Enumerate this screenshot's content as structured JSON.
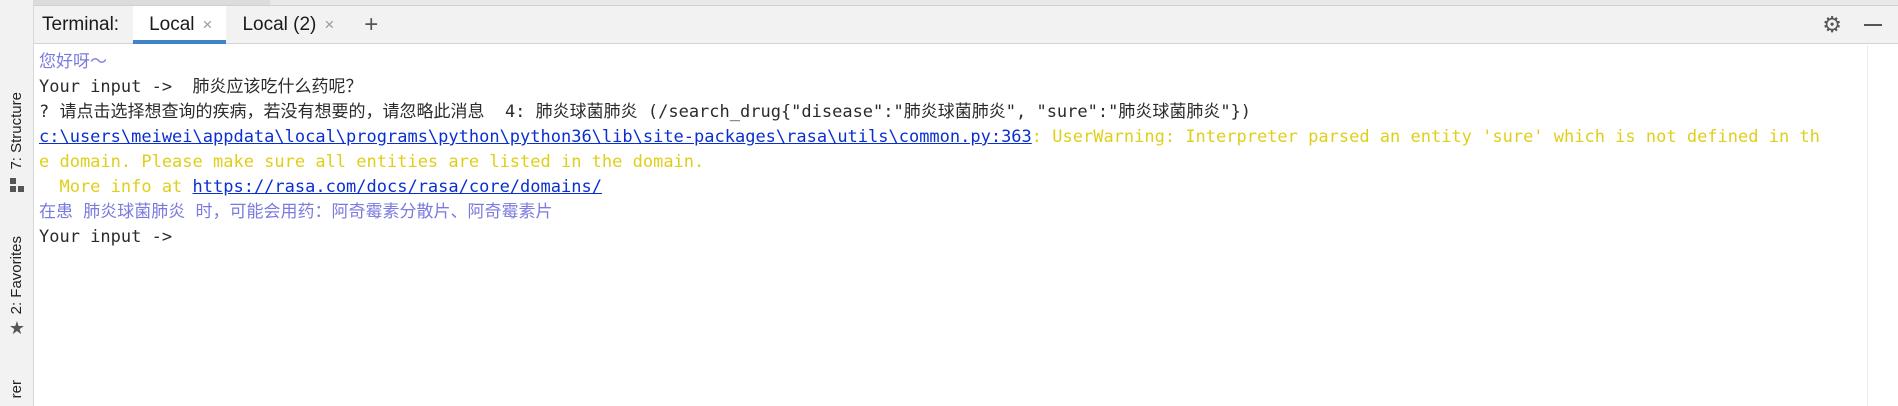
{
  "sidebar": {
    "structure_label": "7: Structure",
    "favorites_label": "2: Favorites",
    "explorer_label": "rer"
  },
  "tab_bar": {
    "title": "Terminal:",
    "tabs": [
      {
        "label": "Local",
        "active": true
      },
      {
        "label": "Local (2)",
        "active": false
      }
    ],
    "close_glyph": "×",
    "add_glyph": "+"
  },
  "terminal": {
    "greeting": "您好呀～",
    "prompt1": "Your input -> ",
    "input1": " 肺炎应该吃什么药呢？",
    "question_line": "? 请点击选择想查询的疾病，若没有想要的，请忽略此消息  4: 肺炎球菌肺炎 (/search_drug{\"disease\":\"肺炎球菌肺炎\", \"sure\":\"肺炎球菌肺炎\"})",
    "warning_path": "c:\\users\\meiwei\\appdata\\local\\programs\\python\\python36\\lib\\site-packages\\rasa\\utils\\common.py:363",
    "warning_text1": ": UserWarning: Interpreter parsed an entity 'sure' which is not defined in th",
    "warning_text2": "e domain. Please make sure all entities are listed in the domain.",
    "more_info_prefix": "  More info at ",
    "more_info_link": "https://rasa.com/docs/rasa/core/domains/",
    "answer": "在患 肺炎球菌肺炎 时，可能会用药：阿奇霉素分散片、阿奇霉素片",
    "prompt2": "Your input ->"
  },
  "colors": {
    "bot_text": "#7a7adf",
    "warning": "#e0cf1a",
    "link": "#0a2fd0",
    "tab_underline": "#4083c9"
  },
  "icons": {
    "settings": "gear-icon",
    "hide": "hide-icon",
    "structure": "structure-icon",
    "favorites": "star-icon"
  }
}
